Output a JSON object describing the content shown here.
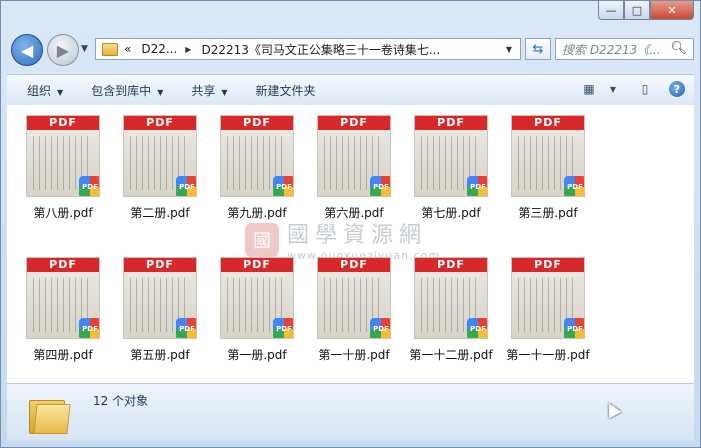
{
  "caption": {
    "minimize": "—",
    "maximize": "□",
    "close": "✕"
  },
  "nav": {
    "back_icon": "back-arrow-icon",
    "forward_icon": "forward-arrow-icon",
    "history_drop": "▼"
  },
  "address": {
    "chevrons": "«",
    "crumbs": [
      "D22...",
      "D22213《司马文正公集略三十一卷诗集七..."
    ],
    "separator": "▶",
    "dropdown": "▼"
  },
  "refresh_glyph": "⇆",
  "search": {
    "placeholder": "搜索 D22213《...",
    "icon": "search-icon"
  },
  "toolbar": {
    "organize": "组织",
    "include": "包含到库中",
    "share": "共享",
    "new_folder": "新建文件夹",
    "dd": "▼",
    "view_glyph": "▦",
    "view_dd": "▼",
    "pane_glyph": "▯",
    "help": "?"
  },
  "pdf_banner": "PDF",
  "badge_text": "PDF",
  "files": [
    {
      "name": "第八册.pdf"
    },
    {
      "name": "第二册.pdf"
    },
    {
      "name": "第九册.pdf"
    },
    {
      "name": "第六册.pdf"
    },
    {
      "name": "第七册.pdf"
    },
    {
      "name": "第三册.pdf"
    },
    {
      "name": "第四册.pdf"
    },
    {
      "name": "第五册.pdf"
    },
    {
      "name": "第一册.pdf"
    },
    {
      "name": "第一十册.pdf"
    },
    {
      "name": "第一十二册.pdf"
    },
    {
      "name": "第一十一册.pdf"
    }
  ],
  "watermark": {
    "seal": "國",
    "title": "國學資源網",
    "url": "www.guoxueziyuan.com"
  },
  "status": {
    "count": "12 个对象"
  },
  "colors": {
    "pdf_red": "#d7282a",
    "accent": "#2f6fc0"
  }
}
